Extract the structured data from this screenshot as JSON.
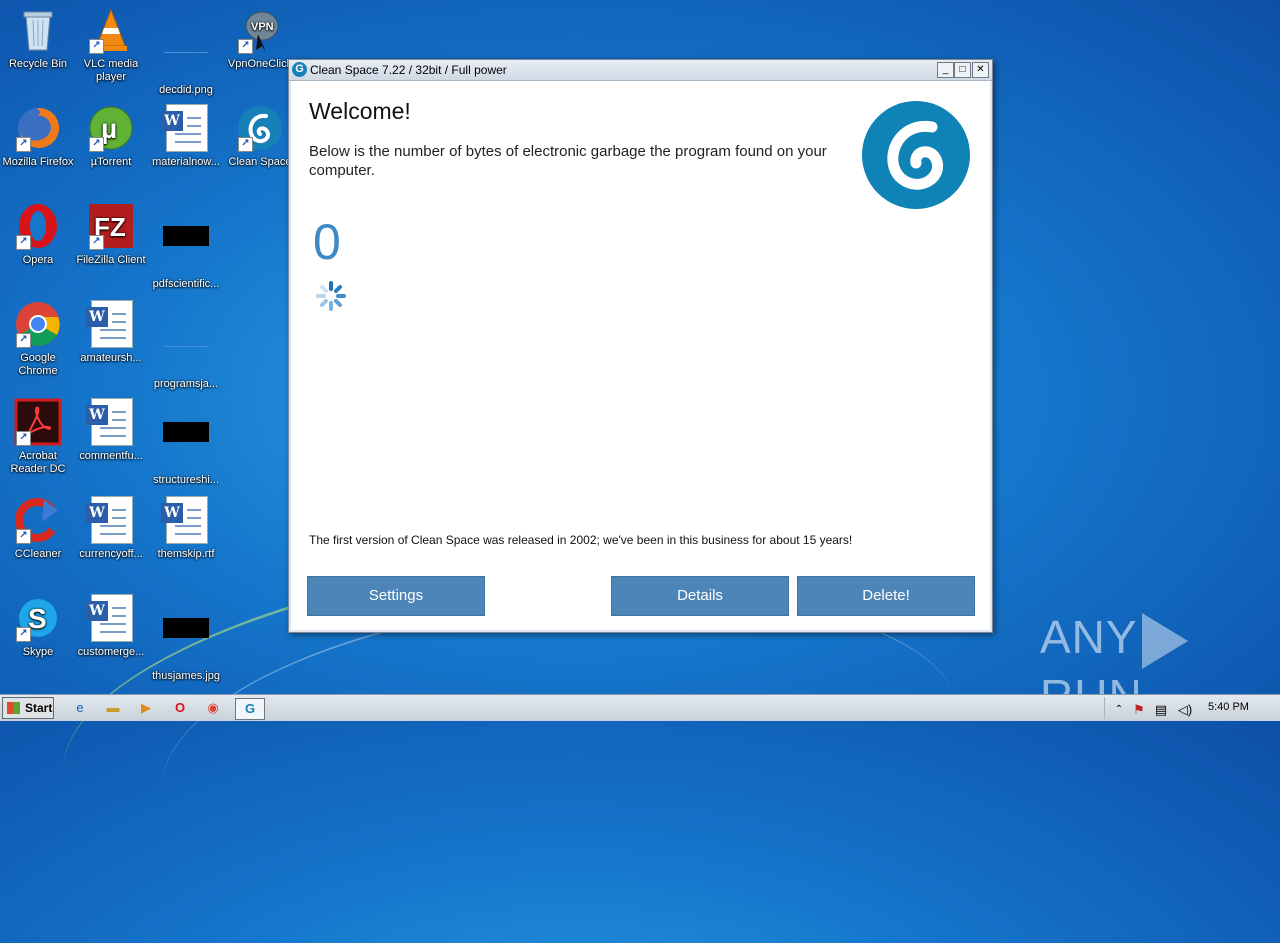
{
  "desktop": {
    "icons": [
      {
        "label": "Recycle Bin",
        "icon": "recycle-bin-icon"
      },
      {
        "label": "VLC media player",
        "icon": "vlc-icon"
      },
      {
        "label": "decdid.png",
        "icon": "image-file-icon"
      },
      {
        "label": "VpnOneClick",
        "icon": "vpn-icon"
      },
      {
        "label": "Mozilla Firefox",
        "icon": "firefox-icon"
      },
      {
        "label": "µTorrent",
        "icon": "utorrent-icon"
      },
      {
        "label": "materialnow...",
        "icon": "word-doc-icon"
      },
      {
        "label": "Clean Space",
        "icon": "clean-space-icon"
      },
      {
        "label": "Opera",
        "icon": "opera-icon"
      },
      {
        "label": "FileZilla Client",
        "icon": "filezilla-icon"
      },
      {
        "label": "pdfscientific...",
        "icon": "file-icon"
      },
      {
        "label": "Google Chrome",
        "icon": "chrome-icon"
      },
      {
        "label": "amateursh...",
        "icon": "word-doc-icon"
      },
      {
        "label": "programsja...",
        "icon": "file-icon"
      },
      {
        "label": "Acrobat Reader DC",
        "icon": "acrobat-icon"
      },
      {
        "label": "commentfu...",
        "icon": "word-doc-icon"
      },
      {
        "label": "structureshi...",
        "icon": "file-icon"
      },
      {
        "label": "CCleaner",
        "icon": "ccleaner-icon"
      },
      {
        "label": "currencyoff...",
        "icon": "word-doc-icon"
      },
      {
        "label": "themskip.rtf",
        "icon": "word-doc-icon"
      },
      {
        "label": "Skype",
        "icon": "skype-icon"
      },
      {
        "label": "customerge...",
        "icon": "word-doc-icon"
      },
      {
        "label": "thusjames.jpg",
        "icon": "image-file-icon"
      }
    ]
  },
  "window": {
    "title": "Clean Space 7.22 / 32bit / Full power",
    "welcome": "Welcome!",
    "description": "Below is the number of bytes of electronic garbage the program found on your computer.",
    "byte_count": "0",
    "footer_note": "The first version of Clean Space was released in 2002; we've been in this business for about 15 years!",
    "buttons": {
      "settings": "Settings",
      "details": "Details",
      "delete": "Delete!"
    },
    "accent_color": "#4d85b8",
    "logo_color": "#0f83b5"
  },
  "watermark": {
    "left": "ANY",
    "right": "RUN"
  },
  "taskbar": {
    "start_label": "Start",
    "clock": "5:40 PM"
  }
}
